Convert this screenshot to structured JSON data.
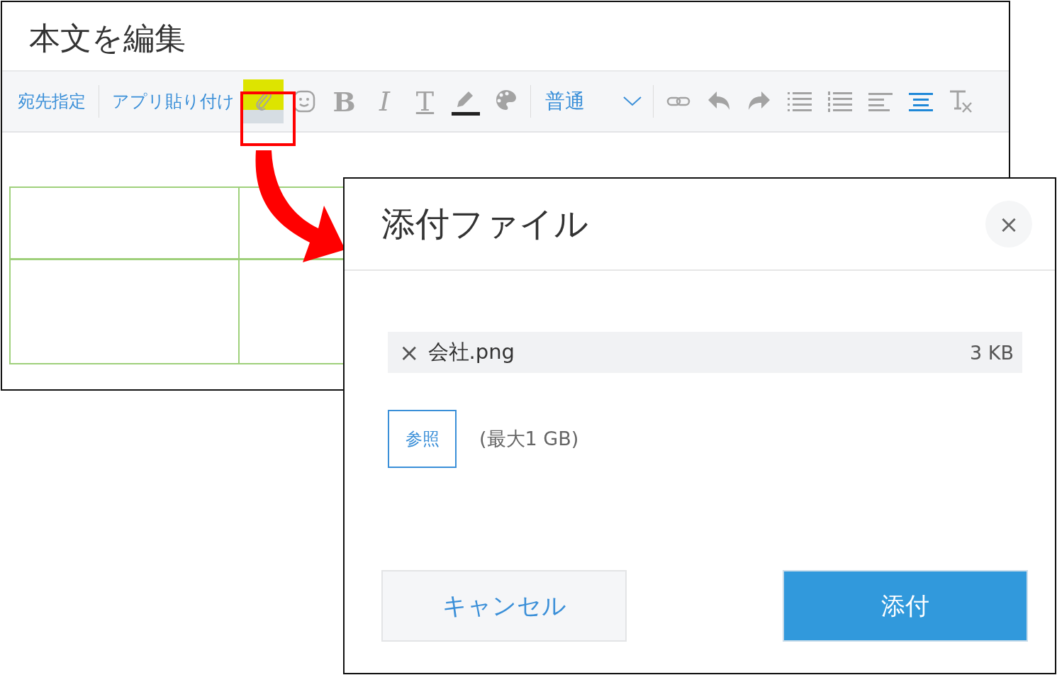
{
  "editor": {
    "title": "本文を編集",
    "toolbar": [
      {
        "kind": "text",
        "label": "宛先指定"
      },
      {
        "kind": "divider"
      },
      {
        "kind": "text",
        "label": "アプリ貼り付け"
      },
      {
        "kind": "attach",
        "active": false,
        "highlighted": true
      },
      {
        "kind": "emoji",
        "active": false,
        "highlighted": false
      },
      {
        "kind": "bold",
        "label": "B",
        "active": false,
        "highlighted": false
      },
      {
        "kind": "italic",
        "label": "I",
        "active": false,
        "highlighted": false
      },
      {
        "kind": "underline",
        "label": "T",
        "active": false,
        "highlighted": false
      },
      {
        "kind": "pen",
        "active": false,
        "highlighted": false
      },
      {
        "kind": "palette",
        "active": false,
        "highlighted": false
      },
      {
        "kind": "divider"
      },
      {
        "kind": "select",
        "label": "普通"
      },
      {
        "kind": "divider"
      },
      {
        "kind": "link",
        "active": false,
        "highlighted": false
      },
      {
        "kind": "undo",
        "active": false,
        "highlighted": false
      },
      {
        "kind": "redo",
        "active": false,
        "highlighted": false
      },
      {
        "kind": "bullets",
        "active": false,
        "highlighted": false
      },
      {
        "kind": "numbers",
        "active": false,
        "highlighted": false
      },
      {
        "kind": "align-left",
        "active": false,
        "highlighted": false
      },
      {
        "kind": "align-center",
        "active": true,
        "highlighted": false
      },
      {
        "kind": "clear-format",
        "active": false,
        "highlighted": false
      }
    ]
  },
  "dialog": {
    "title": "添付ファイル",
    "close": "×",
    "file": {
      "remove": "×",
      "name": "会社.png",
      "size": "3 KB"
    },
    "browse": "参照",
    "limit": "(最大1 GB)",
    "buttons": [
      {
        "kind": "secondary",
        "label": "キャンセル"
      },
      {
        "kind": "primary",
        "label": "添付"
      }
    ]
  }
}
